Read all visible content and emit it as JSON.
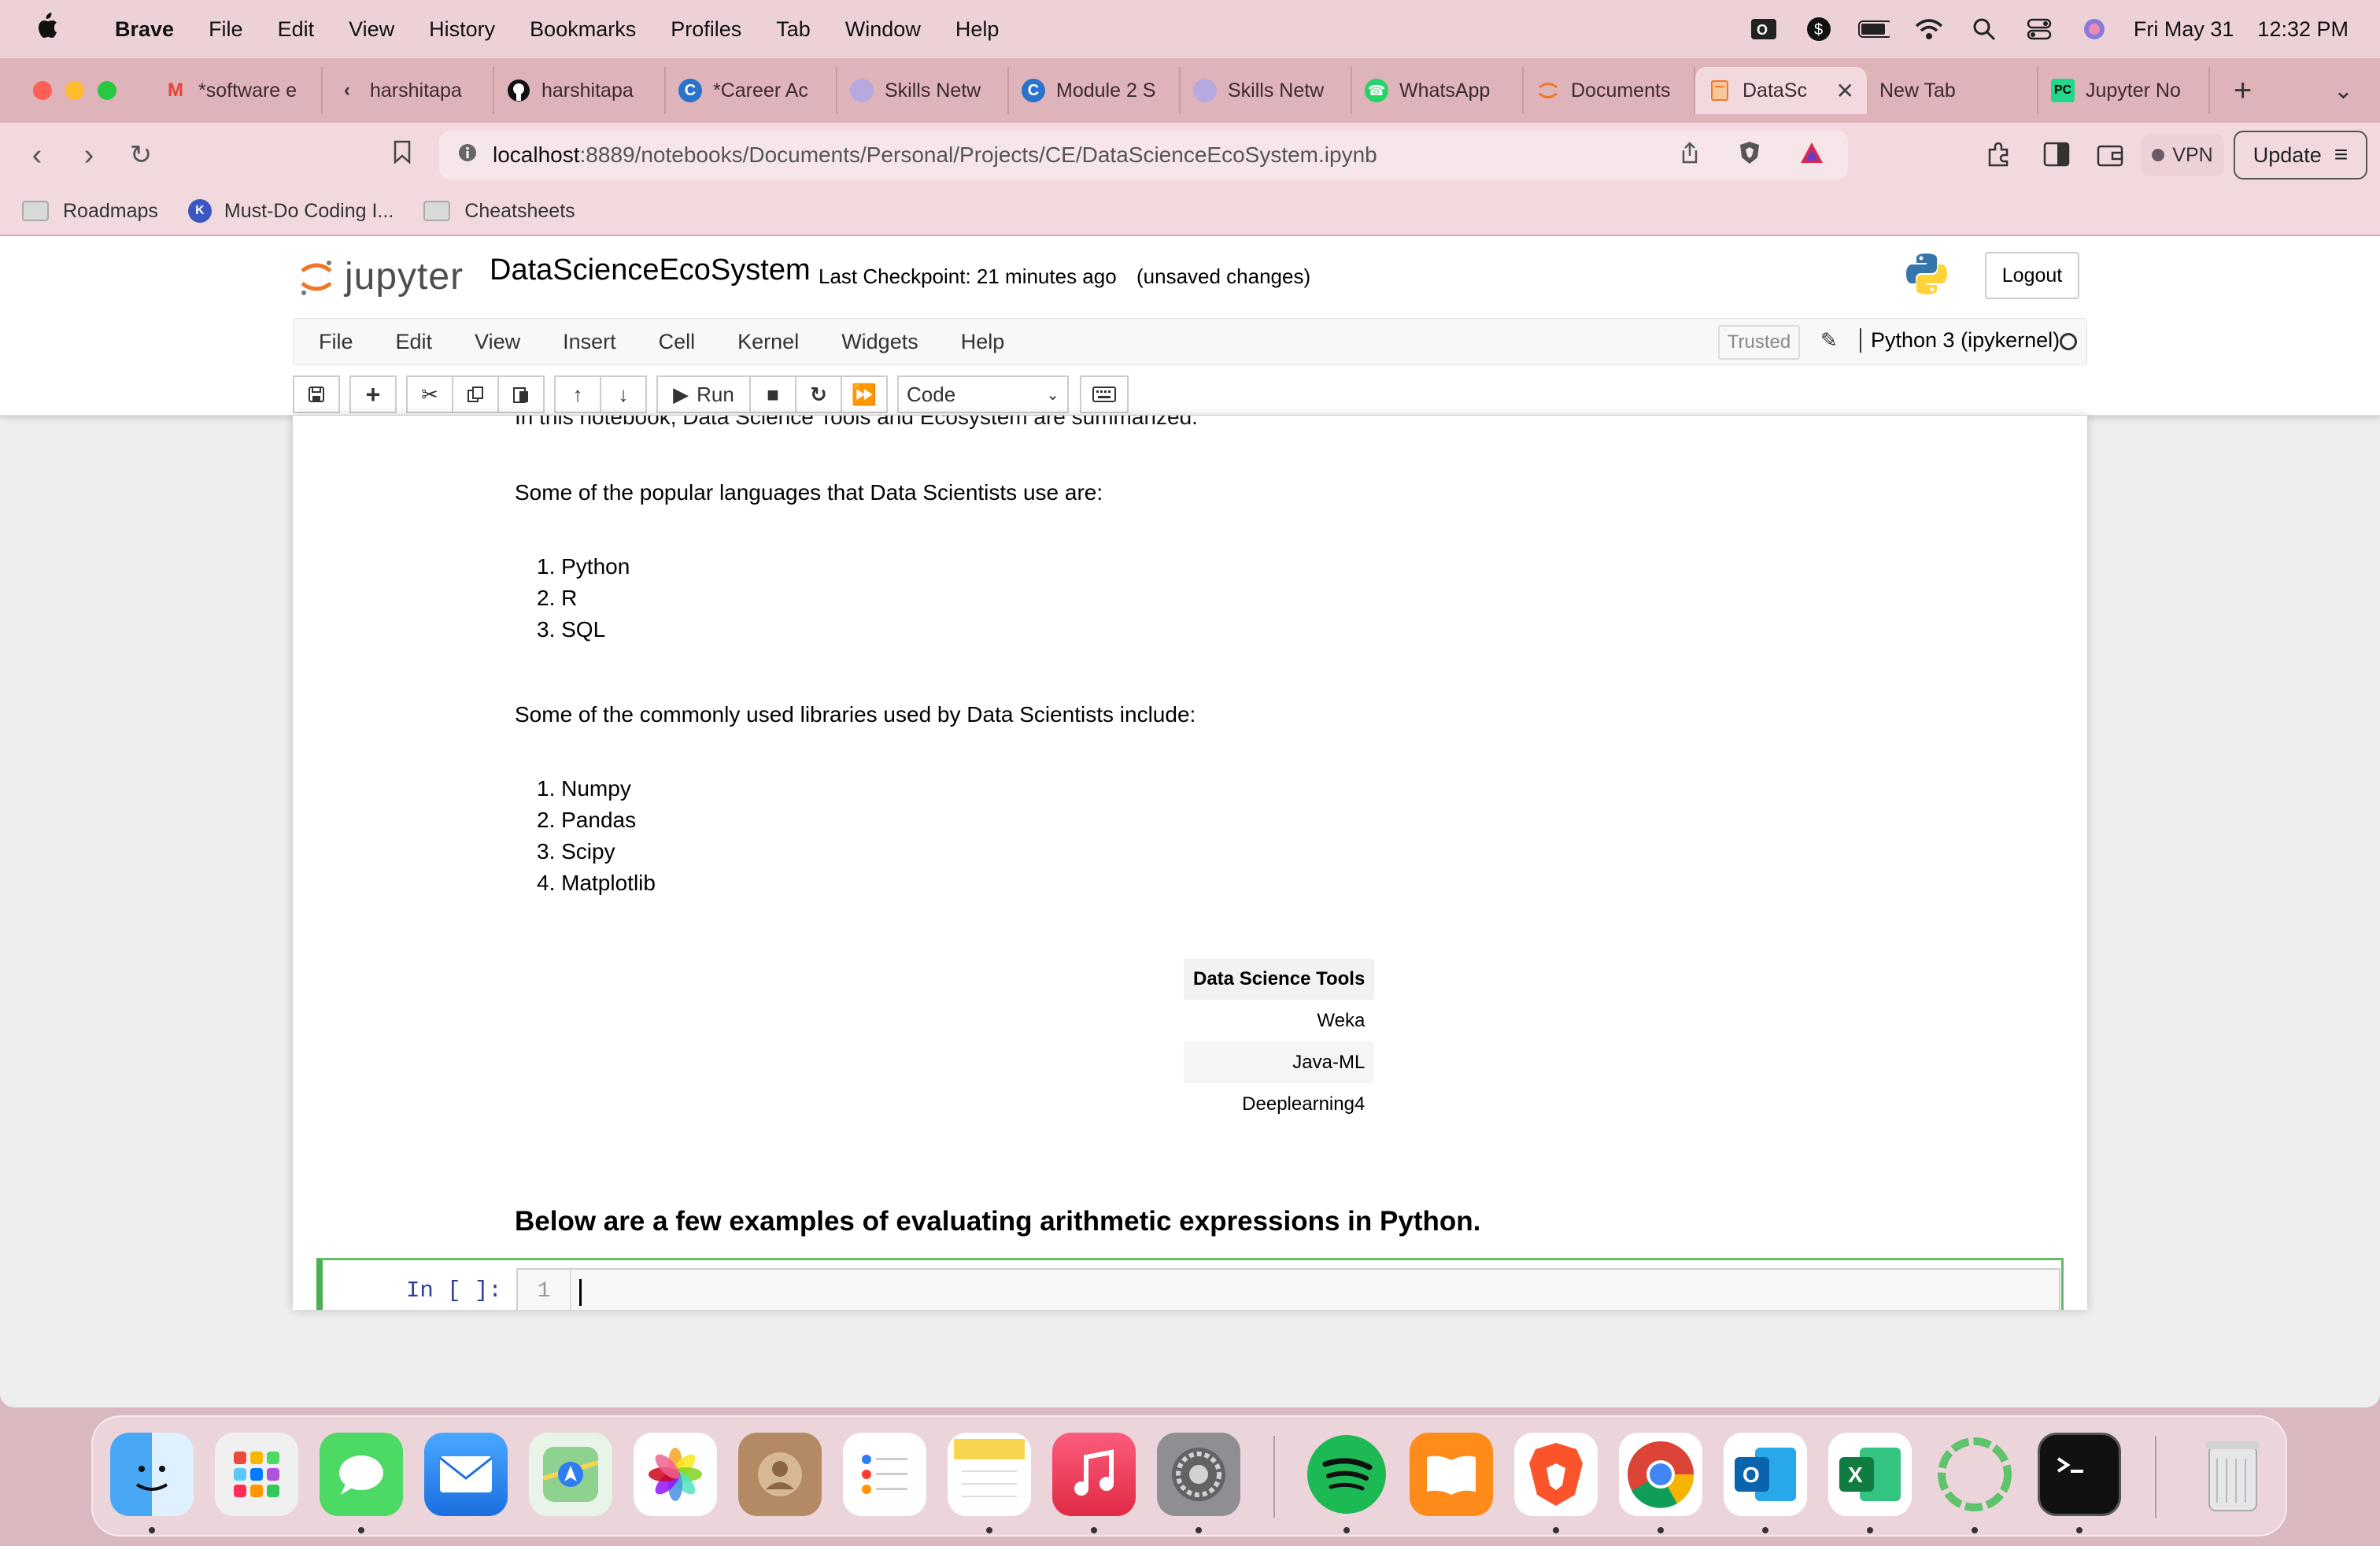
{
  "menubar": {
    "app": "Brave",
    "items": [
      "File",
      "Edit",
      "View",
      "History",
      "Bookmarks",
      "Profiles",
      "Tab",
      "Window",
      "Help"
    ],
    "date": "Fri May 31",
    "time": "12:32 PM"
  },
  "tabs": [
    {
      "label": "*software e",
      "icon": "gmail-icon",
      "color": "#ea4335"
    },
    {
      "label": "harshitapa",
      "icon": "chevron-icon",
      "color": "#333333"
    },
    {
      "label": "harshitapa",
      "icon": "github-icon",
      "color": "#111111"
    },
    {
      "label": "*Career Ac",
      "icon": "coursera-icon",
      "color": "#2a73cc"
    },
    {
      "label": "Skills Netw",
      "icon": "skills-network-icon",
      "color": "#9b8bd0"
    },
    {
      "label": "Module 2 S",
      "icon": "coursera-icon",
      "color": "#2a73cc"
    },
    {
      "label": "Skills Netw",
      "icon": "skills-network-icon",
      "color": "#9b8bd0"
    },
    {
      "label": "WhatsApp",
      "icon": "whatsapp-icon",
      "color": "#25d366"
    },
    {
      "label": "Documents",
      "icon": "jupyter-icon",
      "color": "#f37626"
    },
    {
      "label": "DataSc",
      "icon": "notebook-icon",
      "color": "#f37626",
      "active": true
    },
    {
      "label": "New Tab",
      "icon": "",
      "color": ""
    },
    {
      "label": "Jupyter No",
      "icon": "pycharm-icon",
      "color": "#21d789"
    }
  ],
  "address": {
    "host": "localhost",
    "path": ":8889/notebooks/Documents/Personal/Projects/CE/DataScienceEcoSystem.ipynb",
    "vpn": "VPN",
    "update": "Update"
  },
  "bookmarks": [
    "Roadmaps",
    "Must-Do Coding I...",
    "Cheatsheets"
  ],
  "jupyter": {
    "logo": "jupyter",
    "title": "DataScienceEcoSystem",
    "checkpoint": "Last Checkpoint: 21 minutes ago",
    "unsaved": "(unsaved changes)",
    "logout": "Logout",
    "menu": [
      "File",
      "Edit",
      "View",
      "Insert",
      "Cell",
      "Kernel",
      "Widgets",
      "Help"
    ],
    "trusted": "Trusted",
    "kernel": "Python 3 (ipykernel)",
    "run": "Run",
    "cell_type": "Code"
  },
  "notebook": {
    "intro_partial": "In this notebook, Data Science Tools and Ecosystem are summarized.",
    "languages_heading": "Some of the popular languages that Data Scientists use are:",
    "languages": [
      "1. Python",
      "2. R",
      "3. SQL"
    ],
    "libraries_heading": "Some of the commonly used libraries used by Data Scientists include:",
    "libraries": [
      "1. Numpy",
      "2. Pandas",
      "3. Scipy",
      "4. Matplotlib"
    ],
    "table_header": "Data Science Tools",
    "table_rows": [
      "Weka",
      "Java-ML",
      "Deeplearning4"
    ],
    "arith_heading": "Below are a few examples of evaluating arithmetic expressions in Python.",
    "prompt": "In [ ]:",
    "line_number": "1"
  }
}
